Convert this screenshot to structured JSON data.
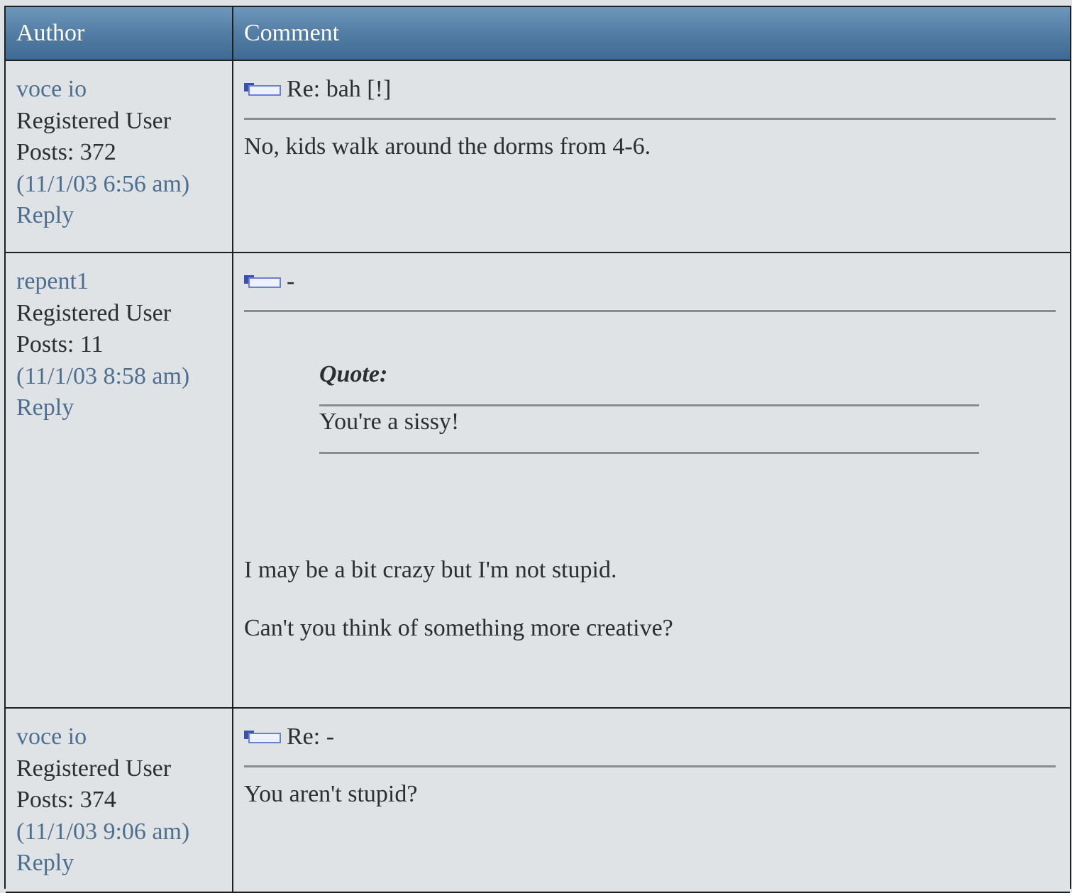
{
  "header": {
    "author_col": "Author",
    "comment_col": "Comment"
  },
  "posts": [
    {
      "author": "voce io",
      "role": "Registered User",
      "posts": "Posts: 372",
      "time": "(11/1/03 6:56 am)",
      "reply": "Reply",
      "subject": "Re: bah [!]",
      "body": "No, kids walk around the dorms from 4-6."
    },
    {
      "author": "repent1",
      "role": "Registered User",
      "posts": "Posts: 11",
      "time": "(11/1/03 8:58 am)",
      "reply": "Reply",
      "subject": "-",
      "quote_label": "Quote:",
      "quote_text": "You're a sissy!",
      "body_lines": [
        "I may be a bit crazy but I'm not stupid.",
        "Can't you think of something more creative?"
      ]
    },
    {
      "author": "voce io",
      "role": "Registered User",
      "posts": "Posts: 374",
      "time": "(11/1/03 9:06 am)",
      "reply": "Reply",
      "subject": "Re: -",
      "body": "You aren't stupid?"
    }
  ]
}
